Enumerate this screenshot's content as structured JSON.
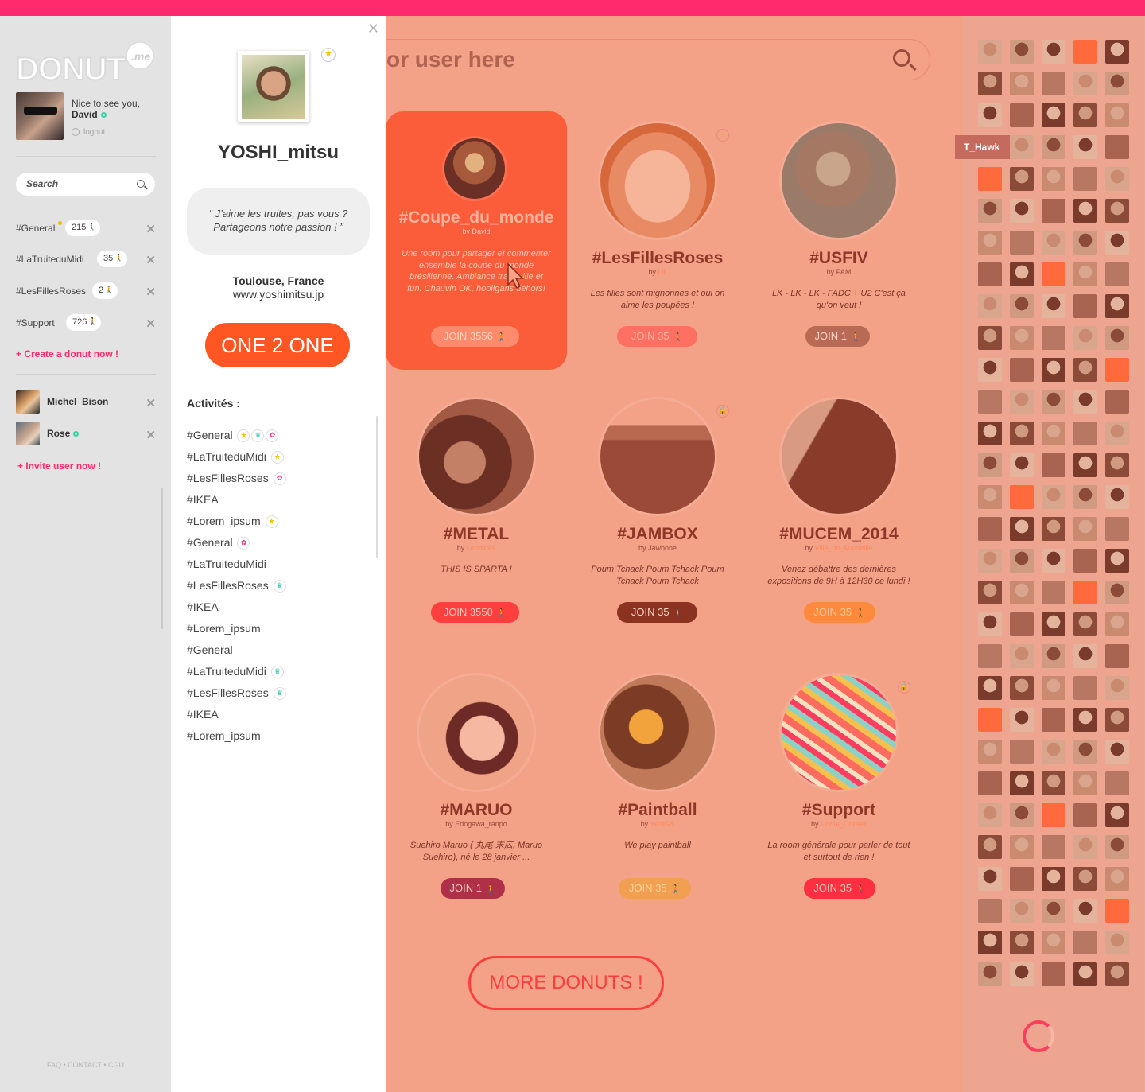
{
  "topbar": {
    "color": "#ff2a6d"
  },
  "sidebar": {
    "logo_text": "DONUT.me",
    "greeting": "Nice to see you,",
    "username": "David",
    "logout": "logout",
    "search_placeholder": "Search",
    "rooms": [
      {
        "name": "#General",
        "count": "215"
      },
      {
        "name": "#LaTruiteduMidi",
        "count": "35"
      },
      {
        "name": "#LesFillesRoses",
        "count": "2"
      },
      {
        "name": "#Support",
        "count": "726"
      }
    ],
    "create_link": "+ Create a donut now !",
    "users": [
      {
        "name": "Michel_Bison"
      },
      {
        "name": "Rose"
      }
    ],
    "invite_link": "+ Invite user now !",
    "footer": "FAQ • CONTACT • CGU"
  },
  "profile": {
    "name": "YOSHI_mitsu",
    "quote_line1": "“ J’aime les truites, pas vous ?",
    "quote_line2": "Partageons notre passion ! ”",
    "location": "Toulouse, France",
    "website": "www.yoshimitsu.jp",
    "one2one": "ONE 2 ONE",
    "activities_title": "Activités :",
    "activities": [
      {
        "name": "#General",
        "badges": [
          "star",
          "crown",
          "flower"
        ]
      },
      {
        "name": "#LaTruiteduMidi",
        "badges": [
          "star"
        ]
      },
      {
        "name": "#LesFillesRoses",
        "badges": [
          "flower"
        ]
      },
      {
        "name": "#IKEA",
        "badges": []
      },
      {
        "name": "#Lorem_ipsum",
        "badges": [
          "star"
        ]
      },
      {
        "name": "#General",
        "badges": [
          "flower"
        ]
      },
      {
        "name": "#LaTruiteduMidi",
        "badges": []
      },
      {
        "name": "#LesFillesRoses",
        "badges": [
          "crown"
        ]
      },
      {
        "name": "#IKEA",
        "badges": []
      },
      {
        "name": "#Lorem_ipsum",
        "badges": []
      },
      {
        "name": "#General",
        "badges": []
      },
      {
        "name": "#LaTruiteduMidi",
        "badges": [
          "crown"
        ]
      },
      {
        "name": "#LesFillesRoses",
        "badges": [
          "crown"
        ]
      },
      {
        "name": "#IKEA",
        "badges": []
      },
      {
        "name": "#Lorem_ipsum",
        "badges": []
      }
    ]
  },
  "main": {
    "search_placeholder": "or user here",
    "cards": [
      {
        "title": "#Coupe_du_monde",
        "by": "by ",
        "author": "David",
        "desc": "Une room pour partager et commenter ensemble la coupe du monde brésilienne. Ambiance tranquille et fun. Chauvin OK, hooligans dehors!",
        "join": "JOIN 3556",
        "join_color": "#ff8866"
      },
      {
        "title": "#LesFillesRoses",
        "by": "by ",
        "author": "Lili",
        "desc": "Les filles sont mignonnes et oui on aime les poupées !",
        "join": "JOIN 35",
        "join_color": "#ff6f62"
      },
      {
        "title": "#USFIV",
        "by": "by ",
        "author": "PAM",
        "desc": "LK - LK - LK - FADC + U2 C'est ça qu'on veut !",
        "join": "JOIN 1",
        "join_color": "#b86a55"
      },
      {
        "title": "#METAL",
        "by": "by ",
        "author": "Leonidas",
        "desc": "THIS IS SPARTA !",
        "join": "JOIN 3550",
        "join_color": "#ff3e3e"
      },
      {
        "title": "#JAMBOX",
        "by": "by ",
        "author": "Jawbone",
        "desc": "Poum Tchack Poum Tchack Poum Tchack Poum Tchack",
        "join": "JOIN 35",
        "join_color": "#8c3220"
      },
      {
        "title": "#MUCEM_2014",
        "by": "by ",
        "author": "Ville_de_Marseille",
        "desc": "Venez débattre des dernières expositions de 9H à 12H30 ce lundi !",
        "join": "JOIN 35",
        "join_color": "#ff8a3d"
      },
      {
        "title": "#MARUO",
        "by": "by ",
        "author": "Edogawa_ranpo",
        "desc": "Suehiro Maruo ( 丸尾 末広, Maruo Suehiro), né le 28 janvier ...",
        "join": "JOIN 1",
        "join_color": "#b0304a"
      },
      {
        "title": "#Paintball",
        "by": "by ",
        "author": "YANGS",
        "desc": "We play paintball",
        "join": "JOIN 35",
        "join_color": "#f0a050"
      },
      {
        "title": "#Support",
        "by": "by ",
        "author": "Donut_Cooker",
        "desc": "La room générale pour parler de tout et surtout de rien !",
        "join": "JOIN 35",
        "join_color": "#ff2e40"
      }
    ],
    "more_button": "MORE DONUTS !"
  },
  "right": {
    "tooltip": "T_Hawk"
  },
  "colors": {
    "accent": "#ff2a6d",
    "orange": "#ff5623",
    "online": "#2fd3a0"
  }
}
